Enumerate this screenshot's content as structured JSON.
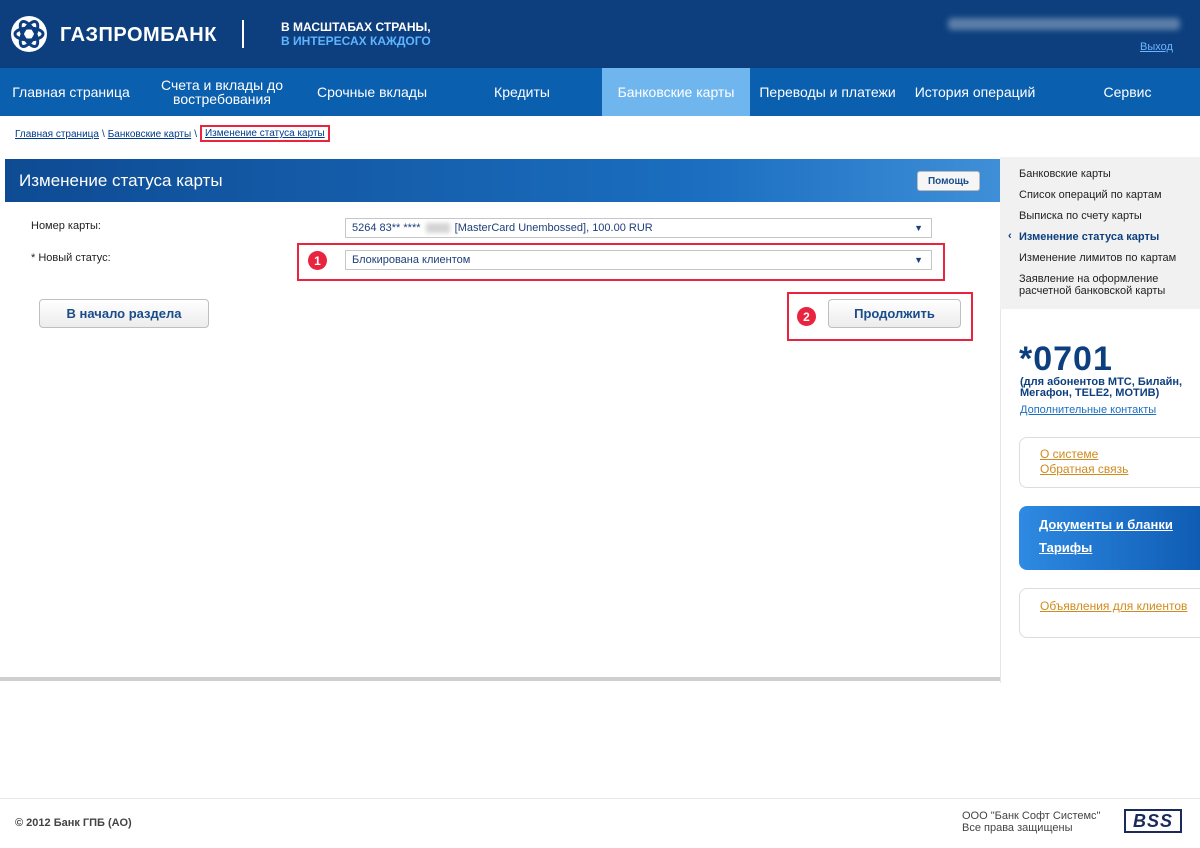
{
  "brand": {
    "name": "ГАЗПРОМБАНК",
    "slogan_line1": "В МАСШТАБАХ СТРАНЫ,",
    "slogan_line2": "В ИНТЕРЕСАХ КАЖДОГО"
  },
  "header": {
    "logout_label": "Выход"
  },
  "nav": {
    "items": [
      {
        "label": "Главная страница"
      },
      {
        "label": "Счета и вклады до востребования"
      },
      {
        "label": "Срочные вклады"
      },
      {
        "label": "Кредиты"
      },
      {
        "label": "Банковские карты",
        "active": true
      },
      {
        "label": "Переводы и платежи"
      },
      {
        "label": "История операций"
      },
      {
        "label": "Сервис"
      }
    ]
  },
  "breadcrumb": {
    "home": "Главная страница",
    "section": "Банковские карты",
    "current": "Изменение статуса карты",
    "separator": "\\"
  },
  "panel": {
    "title": "Изменение статуса карты",
    "help_label": "Помощь"
  },
  "form": {
    "card_label": "Номер карты:",
    "card_value_prefix": "5264 83** ****",
    "card_value_suffix": "[MasterCard Unembossed], 100.00 RUR",
    "status_label": "* Новый статус:",
    "status_value": "Блокирована клиентом",
    "marker1": "1",
    "marker2": "2",
    "back_button": "В начало раздела",
    "continue_button": "Продолжить"
  },
  "sidebar": {
    "menu": [
      {
        "label": "Банковские карты"
      },
      {
        "label": "Список операций по картам"
      },
      {
        "label": "Выписка по счету карты"
      },
      {
        "label": "Изменение статуса карты",
        "active": true
      },
      {
        "label": "Изменение лимитов по картам"
      },
      {
        "label": "Заявление на оформление расчетной банковской карты"
      }
    ],
    "phone": "*0701",
    "phone_note": "(для абонентов МТС, Билайн, Мегафон, TELE2, МОТИВ)",
    "contacts_link": "Дополнительные контакты",
    "about_link": "О системе",
    "feedback_link": "Обратная связь",
    "docs_link": "Документы и бланки",
    "tariffs_link": "Тарифы",
    "announcements_link": "Объявления для клиентов"
  },
  "footer": {
    "copyright": "© 2012 Банк ГПБ (АО)",
    "vendor_line1": "ООО \"Банк Софт Системс\"",
    "vendor_line2": "Все права защищены",
    "vendor_logo_text": "BSS"
  },
  "colors": {
    "header_bg": "#0d3f7e",
    "nav_bg": "#0a5fae",
    "nav_active": "#6fb6ee",
    "highlight": "#e8243f",
    "link_orange": "#d08a1d"
  }
}
